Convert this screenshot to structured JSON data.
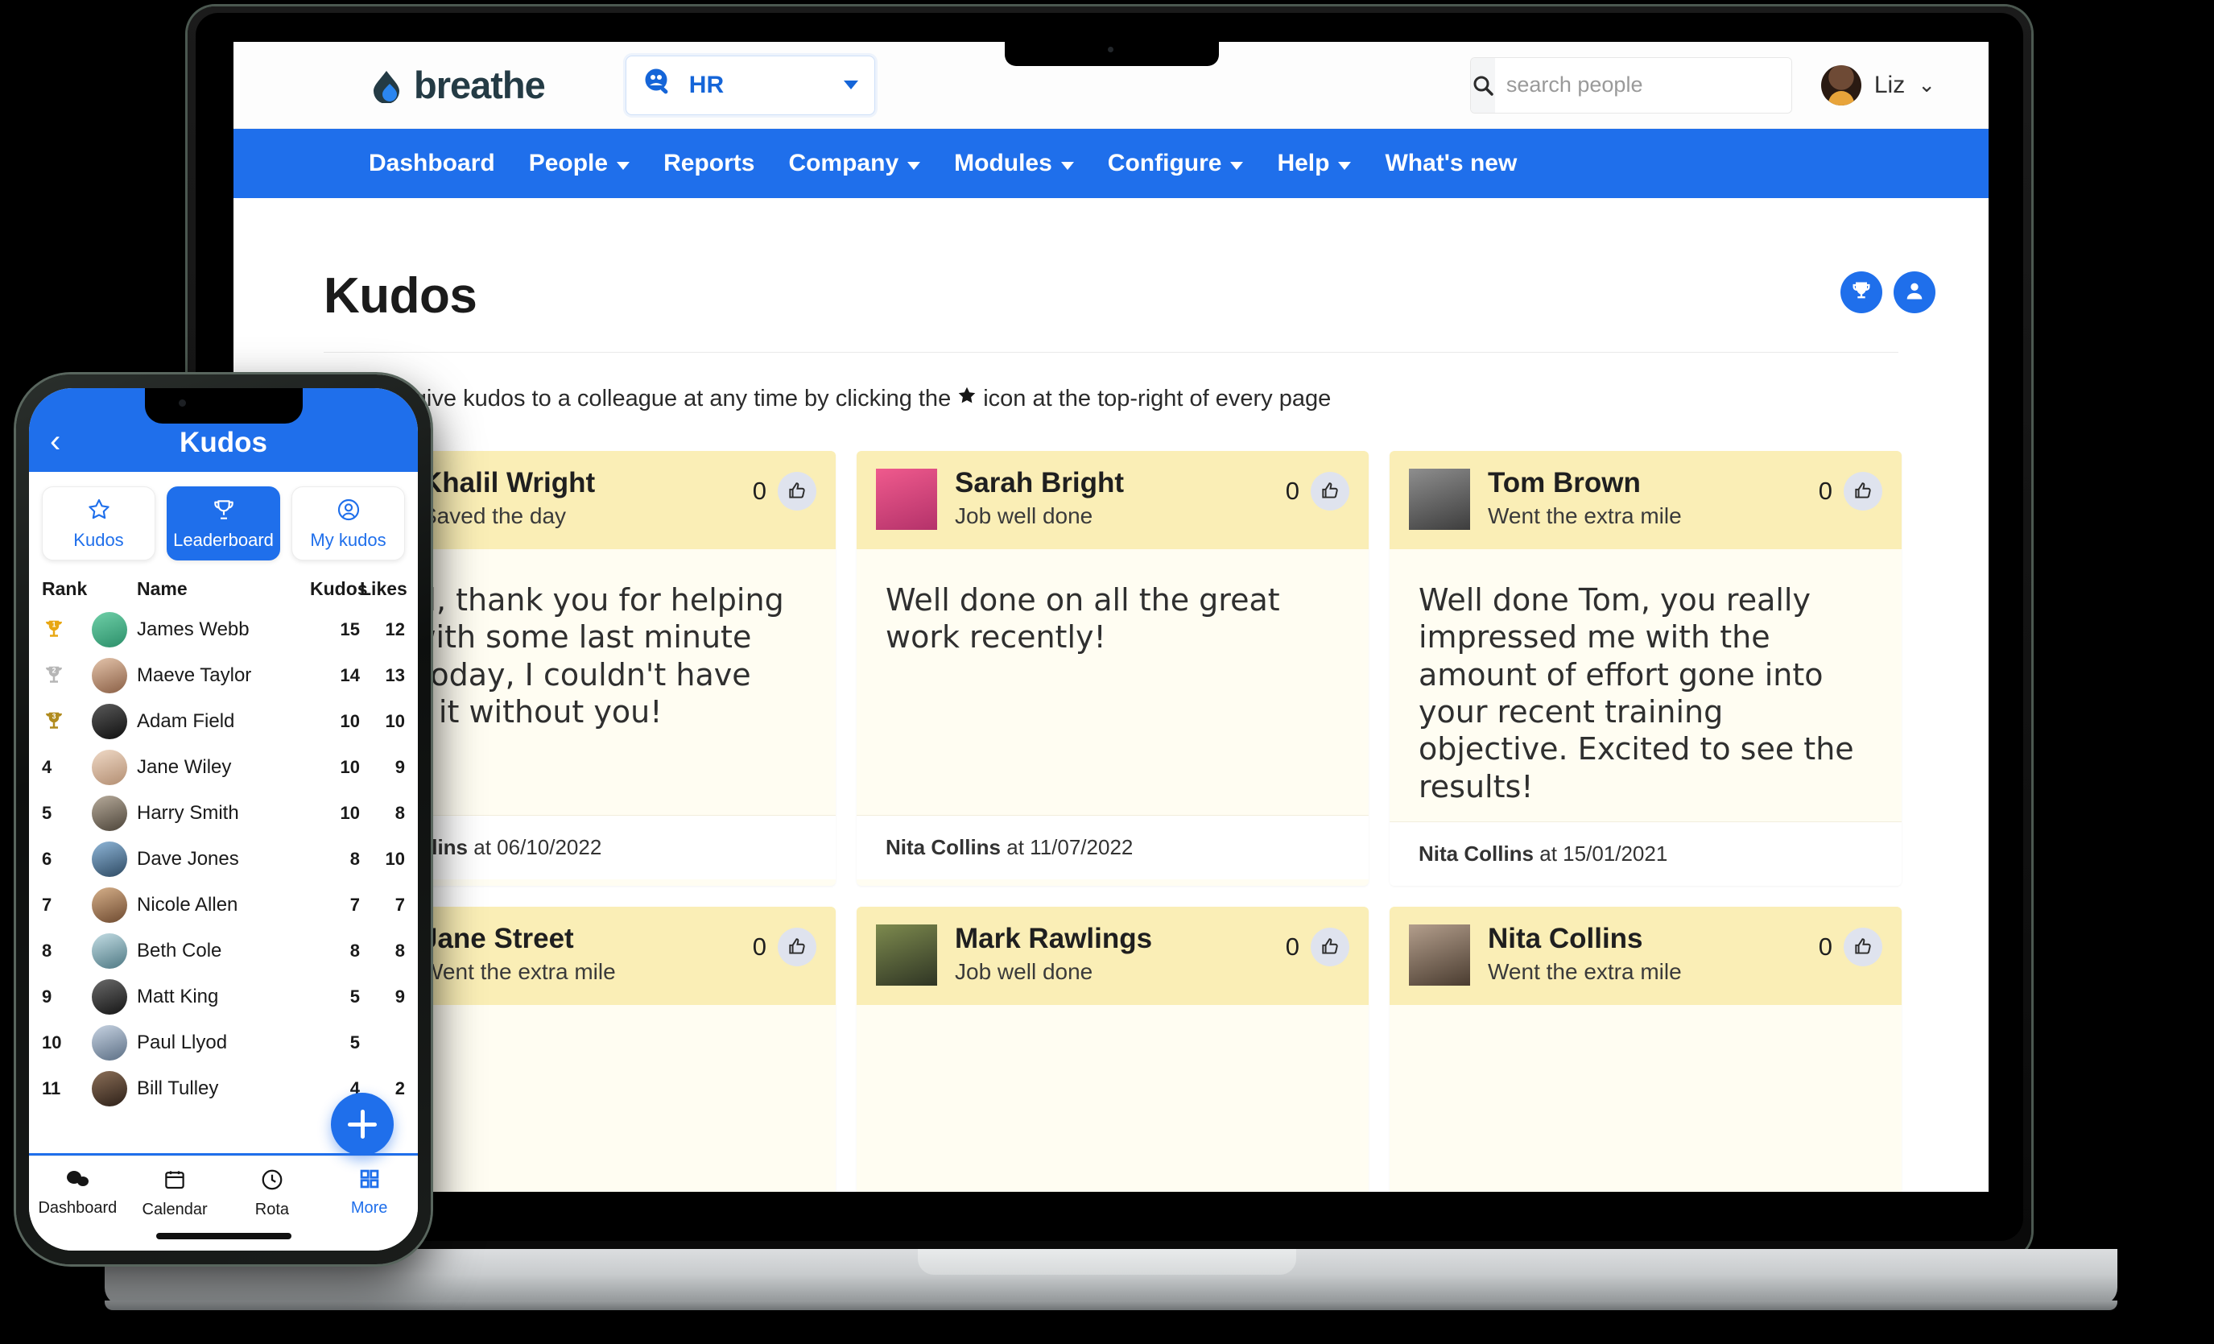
{
  "desktop": {
    "brand": "breathe",
    "module_select": {
      "value": "HR",
      "icon": "people-search-icon"
    },
    "search": {
      "placeholder": "search people",
      "value": "",
      "icon": "search-icon"
    },
    "user": {
      "name": "Liz",
      "avatar": "avatar-liz",
      "chevron": "chevron-down-icon"
    },
    "nav": [
      {
        "label": "Dashboard",
        "has_dropdown": false
      },
      {
        "label": "People",
        "has_dropdown": true
      },
      {
        "label": "Reports",
        "has_dropdown": false
      },
      {
        "label": "Company",
        "has_dropdown": true
      },
      {
        "label": "Modules",
        "has_dropdown": true
      },
      {
        "label": "Configure",
        "has_dropdown": true
      },
      {
        "label": "Help",
        "has_dropdown": true
      },
      {
        "label": "What's new",
        "has_dropdown": false
      }
    ],
    "page": {
      "title": "Kudos",
      "description_before": "You can give kudos to a colleague at any time by clicking the",
      "description_after": "icon at the top-right of every page",
      "description_icon": "star-icon",
      "actions": [
        {
          "name": "leaderboard-button",
          "icon": "trophy-icon"
        },
        {
          "name": "my-kudos-button",
          "icon": "person-icon"
        }
      ]
    },
    "cards": [
      {
        "name": "Khalil Wright",
        "reason": "Saved the day",
        "likes": "0",
        "message": "Khalil, thank you for helping me with some last minute bits today, I couldn't have done it without you!",
        "author": "Nita Collins",
        "at_label": "at",
        "date": "06/10/2022",
        "photo_bg": "#8f8f8f"
      },
      {
        "name": "Sarah Bright",
        "reason": "Job well done",
        "likes": "0",
        "message": "Well done on all the great work recently!",
        "author": "Nita Collins",
        "at_label": "at",
        "date": "11/07/2022",
        "photo_bg": "#e8447f"
      },
      {
        "name": "Tom Brown",
        "reason": "Went the extra mile",
        "likes": "0",
        "message": "Well done Tom, you really impressed me with the amount of effort gone into your recent training objective. Excited to see the results!",
        "author": "Nita Collins",
        "at_label": "at",
        "date": "15/01/2021",
        "photo_bg": "#6e6e6e"
      },
      {
        "name": "Jane Street",
        "reason": "Went the extra mile",
        "likes": "0",
        "message": "",
        "author": "",
        "at_label": "",
        "date": "",
        "photo_bg": "#7b7b7b"
      },
      {
        "name": "Mark Rawlings",
        "reason": "Job well done",
        "likes": "0",
        "message": "",
        "author": "",
        "at_label": "",
        "date": "",
        "photo_bg": "#5d6b3f"
      },
      {
        "name": "Nita Collins",
        "reason": "Went the extra mile",
        "likes": "0",
        "message": "",
        "author": "",
        "at_label": "",
        "date": "",
        "photo_bg": "#8a7f74"
      }
    ]
  },
  "phone": {
    "header": {
      "title": "Kudos",
      "back_icon": "chevron-left-icon"
    },
    "tabs": [
      {
        "label": "Kudos",
        "icon": "star-icon",
        "active": false
      },
      {
        "label": "Leaderboard",
        "icon": "trophy-icon",
        "active": true
      },
      {
        "label": "My kudos",
        "icon": "person-circle-icon",
        "active": false
      }
    ],
    "leaderboard": {
      "columns": [
        "Rank",
        "Name",
        "Kudos",
        "Likes"
      ],
      "rows": [
        {
          "rank": "1",
          "medal": "gold",
          "name": "James Webb",
          "kudos": "15",
          "likes": "12",
          "av": "#49b08a"
        },
        {
          "rank": "2",
          "medal": "silver",
          "name": "Maeve Taylor",
          "kudos": "14",
          "likes": "13",
          "av": "#c9a58c"
        },
        {
          "rank": "3",
          "medal": "bronze",
          "name": "Adam Field",
          "kudos": "10",
          "likes": "10",
          "av": "#2b2b2b"
        },
        {
          "rank": "4",
          "medal": "",
          "name": "Jane Wiley",
          "kudos": "10",
          "likes": "9",
          "av": "#d8c0ae"
        },
        {
          "rank": "5",
          "medal": "",
          "name": "Harry Smith",
          "kudos": "10",
          "likes": "8",
          "av": "#8d8476"
        },
        {
          "rank": "6",
          "medal": "",
          "name": "Dave Jones",
          "kudos": "8",
          "likes": "10",
          "av": "#6f88a5"
        },
        {
          "rank": "7",
          "medal": "",
          "name": "Nicole Allen",
          "kudos": "7",
          "likes": "7",
          "av": "#b08e6e"
        },
        {
          "rank": "8",
          "medal": "",
          "name": "Beth Cole",
          "kudos": "8",
          "likes": "8",
          "av": "#9fc0c8"
        },
        {
          "rank": "9",
          "medal": "",
          "name": "Matt King",
          "kudos": "5",
          "likes": "9",
          "av": "#3a3a3a"
        },
        {
          "rank": "10",
          "medal": "",
          "name": "Paul Llyod",
          "kudos": "5",
          "likes": "",
          "av": "#a3b0c2"
        },
        {
          "rank": "11",
          "medal": "",
          "name": "Bill Tulley",
          "kudos": "4",
          "likes": "2",
          "av": "#5c4a3c"
        }
      ]
    },
    "fab": {
      "icon": "plus-icon"
    },
    "bottom_nav": [
      {
        "label": "Dashboard",
        "icon": "cloud-icon",
        "active": false
      },
      {
        "label": "Calendar",
        "icon": "calendar-icon",
        "active": false
      },
      {
        "label": "Rota",
        "icon": "clock-icon",
        "active": false
      },
      {
        "label": "More",
        "icon": "grid-icon",
        "active": true
      }
    ]
  },
  "colors": {
    "brand_blue": "#1f6feb",
    "card_header": "#faeeb6",
    "card_body": "#fffdf2",
    "logo_dark": "#243b45"
  }
}
